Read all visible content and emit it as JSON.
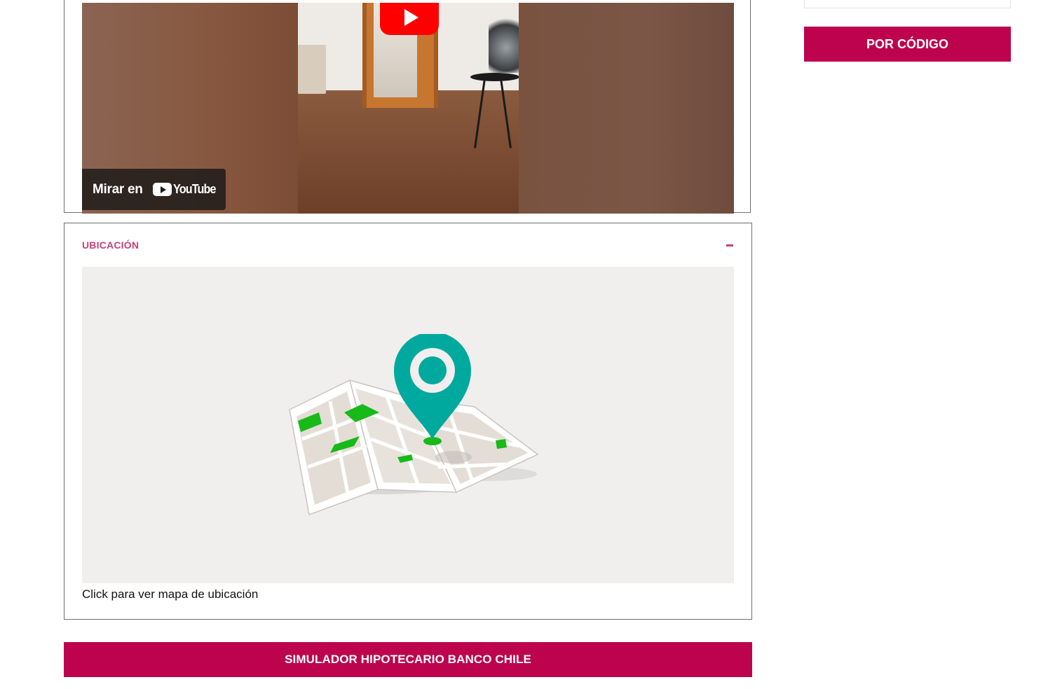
{
  "video": {
    "watch_label": "Mirar en",
    "youtube_brand": "YouTube",
    "play_icon": "youtube-play-icon"
  },
  "location": {
    "title": "UBICACIÓN",
    "collapse_icon": "minus-icon",
    "caption": "Click para ver mapa de ubicación",
    "illustration": "folded-map-with-pin-icon"
  },
  "buttons": {
    "simulador": "SIMULADOR HIPOTECARIO BANCO CHILE",
    "por_codigo": "POR CÓDIGO"
  },
  "colors": {
    "accent": "#bd034d",
    "section_title": "#c4417c",
    "map_pin": "#00a99d",
    "map_green": "#18b918",
    "youtube_red": "#ff0000"
  }
}
